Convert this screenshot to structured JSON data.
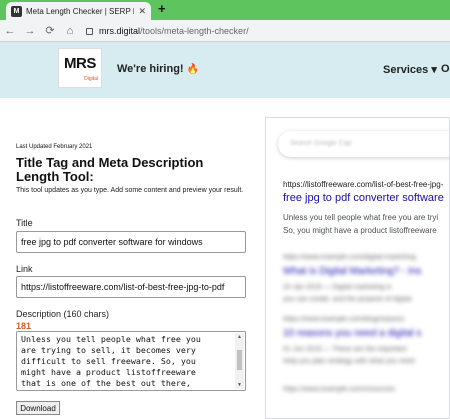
{
  "browser": {
    "tab_title": "Meta Length Checker | SERP Pre...",
    "tab_icon": "mrs-favicon",
    "url_host": "mrs.digital",
    "url_path": "/tools/meta-length-checker/"
  },
  "header": {
    "logo_text": "MRS",
    "logo_sub": "Digital",
    "hiring": "We're hiring!",
    "flame": "🔥",
    "nav_services": "Services",
    "nav_services_caret": "▾",
    "nav_other": "O"
  },
  "tool": {
    "last_updated": "Last Updated February 2021",
    "title": "Title Tag and Meta Description Length Tool:",
    "subtitle": "This tool updates as you type. Add some content and preview your result.",
    "title_label": "Title",
    "title_value": "free jpg to pdf converter software for windows",
    "link_label": "Link",
    "link_value": "https://listoffreeware.com/list-of-best-free-jpg-to-pdf",
    "desc_label": "Description (160 chars)",
    "desc_count": "181",
    "desc_value": "Unless you tell people what free you\nare trying to sell, it becomes very\ndifficult to sell freeware. So, you\nmight have a product listoffreeware\nthat is one of the best out there,",
    "download_label": "Download"
  },
  "serp": {
    "search_placeholder": "Search Google Cap",
    "result_url": "https://listoffreeware.com/list-of-best-free-jpg-",
    "result_title": "free jpg to pdf converter software",
    "result_desc_line1": "Unless you tell people what free you are tryi",
    "result_desc_line2": "So, you might have a product listoffreeware",
    "blur1_url": "https://www.example.com/digital-marketing",
    "blur1_title": "What is Digital Marketing? - Ins",
    "blur1_text1": "24 Jan 2019 — Digital marketing is",
    "blur1_text2": "you can create, and the purpose of digital",
    "blur2_url": "https://www.example.com/blog/reasons",
    "blur2_title": "10 reasons you need a digital s",
    "blur2_text1": "01 Jun 2019 — These are the important",
    "blur2_text2": "Help you plan strategy with what you need",
    "blur3_url": "https://www.example.com/resources"
  },
  "colors": {
    "tab_strip": "#5ec45e",
    "header_bg": "#d6ecf0",
    "accent": "#d25a2c",
    "serp_link": "#1a0dab"
  }
}
